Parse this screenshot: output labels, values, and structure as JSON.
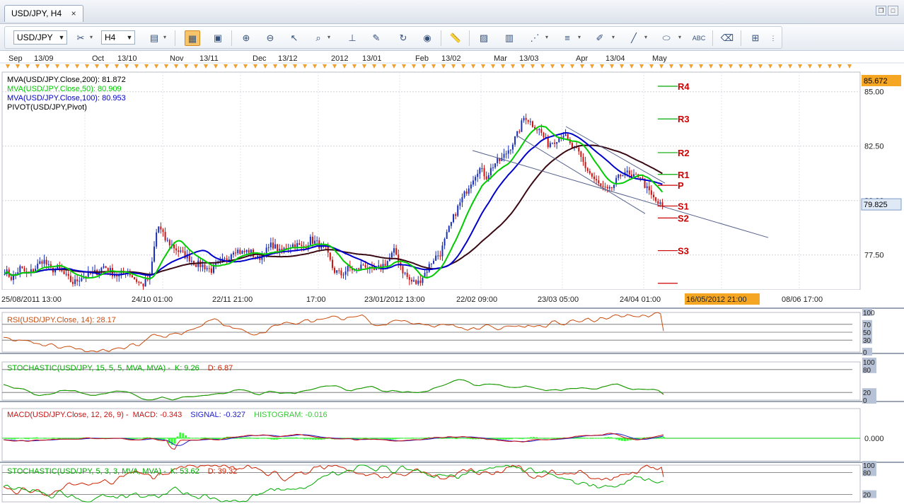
{
  "window": {
    "tab_title": "USD/JPY, H4",
    "close_glyph": "×"
  },
  "toolbar": {
    "symbol": "USD/JPY",
    "timeframe": "H4",
    "icons": [
      "chart-type-icon",
      "crosshair-icon",
      "indicator-icon",
      "zoom-in-icon",
      "zoom-out-icon",
      "cursor-icon",
      "magnifier-icon",
      "level-icon",
      "annotation-icon",
      "refresh-icon",
      "globe-icon",
      "ruler-icon",
      "image-icon",
      "template-icon",
      "fibonacci-icon",
      "line-style-icon",
      "pen-icon",
      "trendline-icon",
      "ellipse-icon",
      "text-icon",
      "eraser-icon",
      "hierarchy-icon"
    ]
  },
  "chart_data": [
    {
      "type": "candlestick",
      "symbol": "USD/JPY",
      "timeframe": "H4",
      "top_month_axis": [
        "Sep",
        "13/09",
        "Oct",
        "13/10",
        "Nov",
        "13/11",
        "Dec",
        "13/12",
        "2012",
        "13/01",
        "Feb",
        "13/02",
        "Mar",
        "13/03",
        "Apr",
        "13/04",
        "May"
      ],
      "x_tick_labels": [
        "25/08/2011 13:00",
        "24/10 01:00",
        "22/11 21:00",
        "17:00",
        "23/01/2012 13:00",
        "22/02 09:00",
        "23/03 05:00",
        "24/04 01:00",
        "16/05/2012 21:00",
        "08/06 17:00"
      ],
      "highlighted_x_label": "16/05/2012 21:00",
      "y_tick_labels": [
        "85.00",
        "82.50",
        "80.00",
        "77.50"
      ],
      "ylim": [
        75.9,
        85.9
      ],
      "last_price": "79.825",
      "top_price_label": "85.672",
      "legend": [
        {
          "text": "MVA(USD/JPY.Close,200): 81.872",
          "color": "#000000"
        },
        {
          "text": "MVA(USD/JPY.Close,50): 80.909",
          "color": "#00cc00"
        },
        {
          "text": "MVA(USD/JPY.Close,100): 80.953",
          "color": "#0000cc"
        },
        {
          "text": "PIVOT(USD/JPY,Pivot)",
          "color": "#000000"
        }
      ],
      "pivot_levels": [
        {
          "label": "R4",
          "value": 85.25
        },
        {
          "label": "R3",
          "value": 83.75
        },
        {
          "label": "R2",
          "value": 82.2
        },
        {
          "label": "R1",
          "value": 81.2
        },
        {
          "label": "P",
          "value": 80.7
        },
        {
          "label": "S1",
          "value": 79.75
        },
        {
          "label": "S2",
          "value": 79.2
        },
        {
          "label": "S3",
          "value": 77.7
        },
        {
          "label": "",
          "value": 76.2
        }
      ],
      "close_series": [
        76.8,
        76.4,
        76.9,
        76.6,
        76.9,
        77.3,
        76.8,
        76.9,
        76.5,
        76.2,
        76.5,
        76.6,
        76.7,
        77.0,
        76.7,
        76.5,
        76.8,
        76.4,
        76.1,
        76.5,
        78.9,
        78.2,
        77.9,
        77.6,
        77.4,
        77.1,
        77.0,
        76.8,
        77.1,
        77.3,
        77.8,
        77.6,
        77.7,
        77.3,
        77.6,
        78.0,
        77.6,
        77.9,
        78.0,
        77.8,
        78.2,
        78.0,
        77.7,
        76.8,
        76.6,
        76.9,
        76.8,
        77.1,
        76.7,
        76.9,
        77.2,
        77.7,
        76.8,
        76.3,
        76.2,
        76.7,
        77.3,
        77.6,
        78.6,
        79.5,
        80.2,
        80.9,
        81.5,
        81.1,
        81.7,
        81.9,
        82.4,
        83.0,
        83.9,
        83.5,
        83.2,
        82.6,
        82.8,
        83.1,
        82.5,
        82.2,
        81.5,
        81.0,
        80.6,
        80.4,
        80.9,
        81.4,
        81.0,
        81.2,
        80.5,
        80.0,
        79.7
      ]
    },
    {
      "type": "line",
      "title": "RSI(USD/JPY.Close, 14): 28.17",
      "y_tick_labels": [
        "100",
        "70",
        "50",
        "30",
        "0"
      ],
      "levels": [
        100,
        70,
        50,
        30,
        0
      ]
    },
    {
      "type": "line",
      "title": "STOCHASTIC(USD/JPY, 15, 5, 5, MVA, MVA) -",
      "k_label": "K: 9.26",
      "d_label": "D: 6.87",
      "y_tick_labels": [
        "100",
        "80",
        "20",
        "0"
      ]
    },
    {
      "type": "line",
      "title": "MACD(USD/JPY.Close, 12, 26, 9) -",
      "macd_label": "MACD: -0.343",
      "signal_label": "SIGNAL: -0.327",
      "histogram_label": "HISTOGRAM: -0.016",
      "y_tick_labels": [
        "0.000"
      ]
    },
    {
      "type": "line",
      "title": "STOCHASTIC(USD/JPY, 5, 3, 3, MVA, MVA) -",
      "k_label": "K: 53.62",
      "d_label": "D: 39.32",
      "y_tick_labels": [
        "100",
        "80",
        "20"
      ]
    }
  ]
}
